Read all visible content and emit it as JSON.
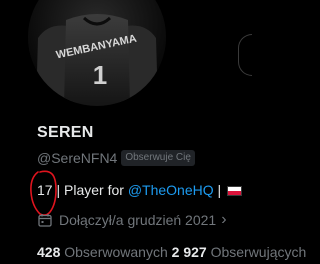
{
  "profile": {
    "display_name": "SEREN",
    "handle": "@SereNFN4",
    "follows_you_badge": "Obserwuje Cię",
    "bio": {
      "number": "17",
      "separator": " | ",
      "text": "Player for ",
      "mention": "@TheOneHQ",
      "separator_end": " |",
      "flag_icon": "poland-flag-icon"
    },
    "joined": "Dołączył/a grudzień 2021",
    "joined_icon": "calendar-icon",
    "stats": {
      "following_count": "428",
      "following_label": " Obserwowanych",
      "followers_count": "2 927",
      "followers_label": " Obserwujących"
    },
    "avatar": {
      "jersey_name": "WEMBANYAMA",
      "jersey_number": "1"
    }
  },
  "colors": {
    "background": "#000000",
    "text_primary": "#e7e9ea",
    "text_secondary": "#71767b",
    "link": "#1d9bf0",
    "annotation": "#e0141e"
  }
}
